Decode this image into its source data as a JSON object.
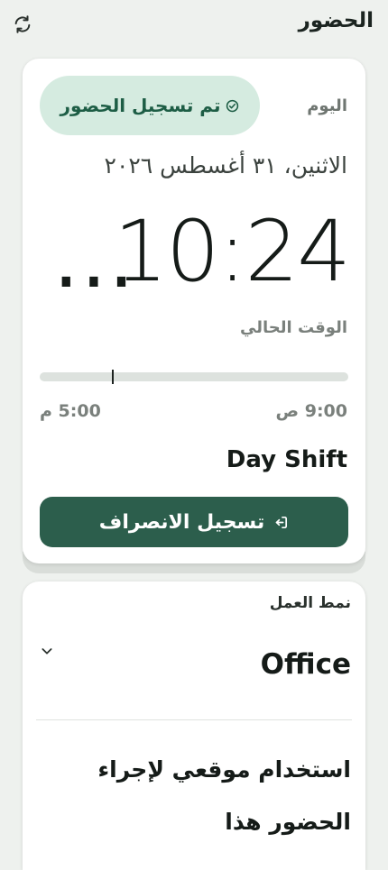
{
  "header": {
    "title": "الحضور",
    "refresh_icon": "refresh-icon"
  },
  "attendance_card": {
    "today_label": "اليوم",
    "status_badge": "تم تسجيل الحضور",
    "date": "الاثنين، ٣١ أغسطس ٢٠٢٦",
    "current_time": "10:24",
    "time_suffix": "...",
    "current_time_label": "الوقت الحالي",
    "shift_start": "9:00 ص",
    "shift_end": "5:00 م",
    "shift_progress": 0.76,
    "shift_name": "Day Shift",
    "checkout_button": "تسجيل الانصراف",
    "colors": {
      "accent": "#2c5e4c",
      "badge_bg": "#d5ebe0",
      "badge_text": "#1d5d45"
    }
  },
  "work_mode_card": {
    "label": "نمط العمل",
    "selected": "Office",
    "location_consent": "استخدام موقعي لإجراء الحضور هذا"
  }
}
